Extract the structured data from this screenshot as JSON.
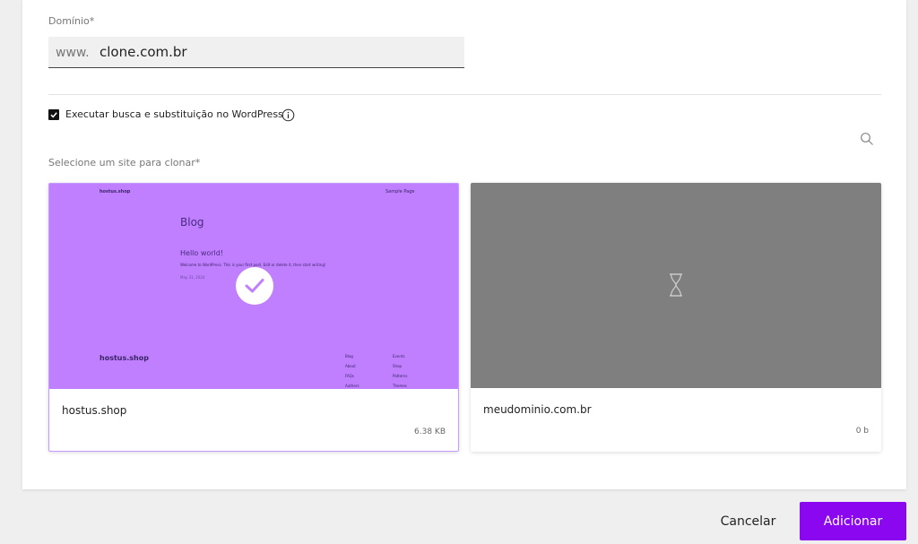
{
  "form": {
    "domain_label": "Domínio*",
    "domain_prefix": "www.",
    "domain_value": "clone.com.br",
    "search_replace_label": "Executar busca e substituição no WordPress",
    "search_replace_checked": true,
    "select_site_label": "Selecione um site para clonar*"
  },
  "sites": [
    {
      "name": "hostus.shop",
      "size": "6.38 KB",
      "selected": true,
      "preview": {
        "brand": "hostus.shop",
        "sample_page": "Sample Page",
        "heading": "Blog",
        "post_title": "Hello world!",
        "post_excerpt": "Welcome to WordPress. This is your first post. Edit or delete it, then start writing!",
        "post_date": "May 31, 2024",
        "footer_brand": "hostus.shop",
        "footer_links_col1": [
          "Blog",
          "About",
          "FAQs",
          "Authors"
        ],
        "footer_links_col2": [
          "Events",
          "Shop",
          "Patterns",
          "Themes"
        ]
      }
    },
    {
      "name": "meudominio.com.br",
      "size": "0 b",
      "selected": false
    }
  ],
  "actions": {
    "cancel_label": "Cancelar",
    "add_label": "Adicionar"
  },
  "colors": {
    "accent": "#8a07f0",
    "selected_thumb": "#c07fff",
    "loading_thumb": "#7f7f7f"
  }
}
